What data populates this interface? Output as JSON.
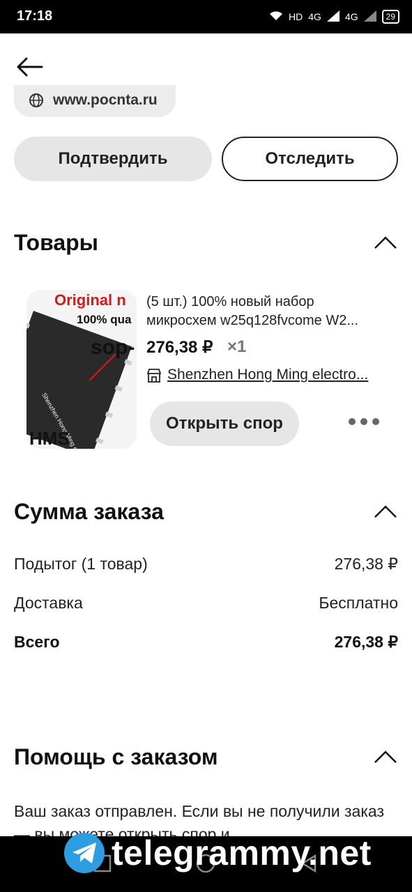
{
  "status_bar": {
    "time": "17:18",
    "battery": "29",
    "network_a": "4G",
    "network_b": "4G",
    "hd": "HD"
  },
  "header": {
    "back_icon": "arrow-left-icon"
  },
  "site_pill": {
    "text": "www.pocnta.ru",
    "icon": "globe-icon"
  },
  "actions": {
    "confirm_label": "Подтвердить",
    "track_label": "Отследить"
  },
  "products": {
    "title": "Товары",
    "item": {
      "title_line1": "(5 шт.) 100% новый набор",
      "title_line2": "микросхем w25q128fvcome W2...",
      "price": "276,38 ₽",
      "qty": "×1",
      "store": "Shenzhen Hong Ming electro...",
      "dispute_label": "Открыть спор",
      "image_text": {
        "line1": "Original n",
        "line2": "100% qua",
        "line3": "sop-",
        "line4": "HMS",
        "diag": "Shenzhen Hong Ming electronics co., LTD"
      }
    }
  },
  "summary": {
    "title": "Сумма заказа",
    "subtotal_label": "Подытог (1 товар)",
    "subtotal_value": "276,38 ₽",
    "delivery_label": "Доставка",
    "delivery_value": "Бесплатно",
    "total_label": "Всего",
    "total_value": "276,38 ₽"
  },
  "help": {
    "title": "Помощь с заказом",
    "text": "Ваш заказ отправлен. Если вы не получили заказ — вы можете открыть спор и"
  },
  "watermark": {
    "text": "telegrammy.net"
  },
  "colors": {
    "background": "#ffffff",
    "pill": "#e6e6e6",
    "text": "#111111",
    "statusbar": "#000000"
  }
}
